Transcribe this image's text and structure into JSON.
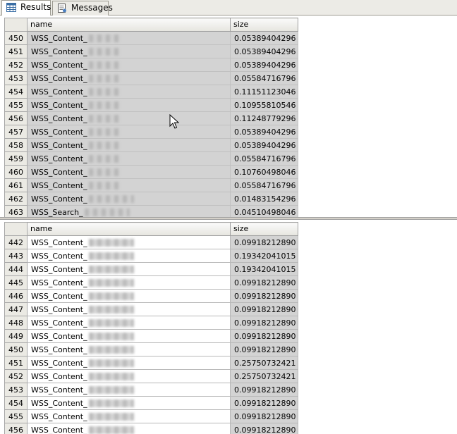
{
  "tabs": [
    {
      "label": "Results",
      "icon": "grid-icon",
      "active": true
    },
    {
      "label": "Messages",
      "icon": "messages-icon",
      "active": false
    }
  ],
  "columns": {
    "name": "name",
    "size": "size"
  },
  "top_grid": {
    "rows": [
      {
        "num": "450",
        "name": "WSS_Content_",
        "size": "0.05389404296"
      },
      {
        "num": "451",
        "name": "WSS_Content_",
        "size": "0.05389404296"
      },
      {
        "num": "452",
        "name": "WSS_Content_",
        "size": "0.05389404296"
      },
      {
        "num": "453",
        "name": "WSS_Content_",
        "size": "0.05584716796"
      },
      {
        "num": "454",
        "name": "WSS_Content_",
        "size": "0.11151123046"
      },
      {
        "num": "455",
        "name": "WSS_Content_",
        "size": "0.10955810546"
      },
      {
        "num": "456",
        "name": "WSS_Content_",
        "size": "0.11248779296"
      },
      {
        "num": "457",
        "name": "WSS_Content_",
        "size": "0.05389404296"
      },
      {
        "num": "458",
        "name": "WSS_Content_",
        "size": "0.05389404296"
      },
      {
        "num": "459",
        "name": "WSS_Content_",
        "size": "0.05584716796"
      },
      {
        "num": "460",
        "name": "WSS_Content_",
        "size": "0.10760498046"
      },
      {
        "num": "461",
        "name": "WSS_Content_",
        "size": "0.05584716796"
      },
      {
        "num": "462",
        "name": "WSS_Content_",
        "size": "0.01483154296"
      },
      {
        "num": "463",
        "name": "WSS_Search_",
        "size": "0.04510498046"
      }
    ]
  },
  "bottom_grid": {
    "rows": [
      {
        "num": "442",
        "name": "WSS_Content_",
        "size": "0.09918212890"
      },
      {
        "num": "443",
        "name": "WSS_Content_",
        "size": "0.19342041015"
      },
      {
        "num": "444",
        "name": "WSS_Content_",
        "size": "0.19342041015"
      },
      {
        "num": "445",
        "name": "WSS_Content_",
        "size": "0.09918212890"
      },
      {
        "num": "446",
        "name": "WSS_Content_",
        "size": "0.09918212890"
      },
      {
        "num": "447",
        "name": "WSS_Content_",
        "size": "0.09918212890"
      },
      {
        "num": "448",
        "name": "WSS_Content_",
        "size": "0.09918212890"
      },
      {
        "num": "449",
        "name": "WSS_Content_",
        "size": "0.09918212890"
      },
      {
        "num": "450",
        "name": "WSS_Content_",
        "size": "0.09918212890"
      },
      {
        "num": "451",
        "name": "WSS_Content_",
        "size": "0.25750732421"
      },
      {
        "num": "452",
        "name": "WSS_Content_",
        "size": "0.25750732421"
      },
      {
        "num": "453",
        "name": "WSS_Content_",
        "size": "0.09918212890"
      },
      {
        "num": "454",
        "name": "WSS_Content_",
        "size": "0.09918212890"
      },
      {
        "num": "455",
        "name": "WSS_Content_",
        "size": "0.09918212890"
      },
      {
        "num": "456",
        "name": "WSS_Content_",
        "size": "0.09918212890"
      }
    ]
  },
  "colors": {
    "selection": "#d3d3d3",
    "header": "#e6e5df",
    "row_header": "#ebeae4"
  },
  "cursor_icon": "mouse-pointer-icon"
}
